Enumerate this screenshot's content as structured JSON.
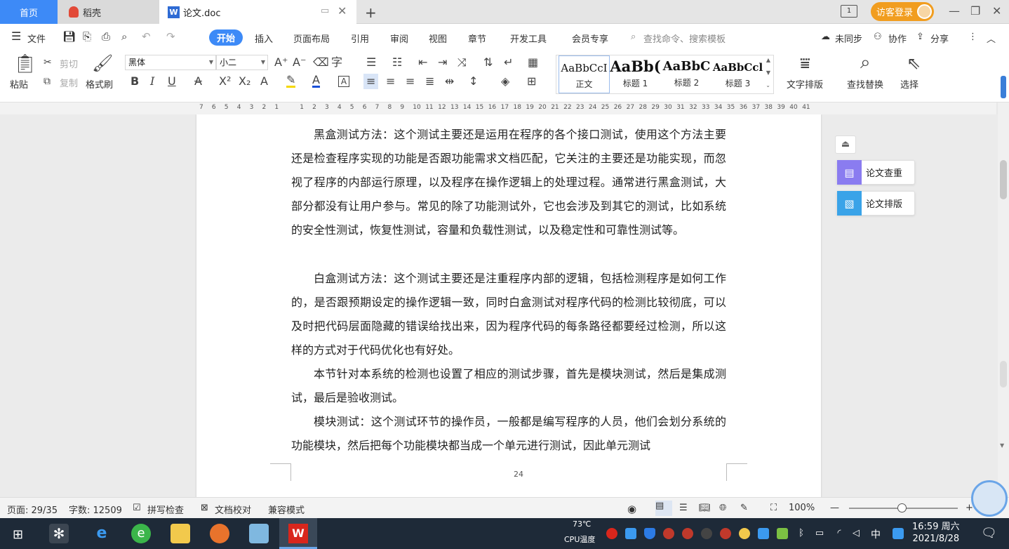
{
  "tabs": [
    {
      "label": "首页"
    },
    {
      "label": "稻壳"
    },
    {
      "label": "论文.doc"
    }
  ],
  "account": {
    "login_label": "访客登录"
  },
  "menu": {
    "file": "文件",
    "items": [
      "开始",
      "插入",
      "页面布局",
      "引用",
      "审阅",
      "视图",
      "章节",
      "开发工具",
      "会员专享"
    ],
    "search_placeholder": "查找命令、搜索模板",
    "sync": "未同步",
    "collab": "协作",
    "share": "分享"
  },
  "ribbon": {
    "paste": "粘贴",
    "cut": "剪切",
    "copy": "复制",
    "format_painter": "格式刷",
    "font_name": "黑体",
    "font_size": "小二",
    "styles": [
      {
        "preview": "AaBbCcI",
        "name": "正文"
      },
      {
        "preview": "AaBb(",
        "name": "标题 1"
      },
      {
        "preview": "AaBbC",
        "name": "标题 2"
      },
      {
        "preview": "AaBbCcl",
        "name": "标题 3"
      }
    ],
    "text_layout": "文字排版",
    "find_replace": "查找替换",
    "select": "选择"
  },
  "ruler": {
    "ticks": [
      "7",
      "6",
      "5",
      "4",
      "3",
      "2",
      "1",
      "",
      "1",
      "2",
      "3",
      "4",
      "5",
      "6",
      "7",
      "8",
      "9",
      "10",
      "11",
      "12",
      "13",
      "14",
      "15",
      "16",
      "17",
      "18",
      "19",
      "20",
      "21",
      "22",
      "23",
      "24",
      "25",
      "26",
      "27",
      "28",
      "29",
      "30",
      "31",
      "32",
      "33",
      "34",
      "35",
      "36",
      "37",
      "38",
      "39",
      "40",
      "41"
    ]
  },
  "document": {
    "paragraphs": [
      "黑盒测试方法：这个测试主要还是运用在程序的各个接口测试，使用这个方法主要还是检查程序实现的功能是否跟功能需求文档匹配，它关注的主要还是功能实现，而忽视了程序的内部运行原理，以及程序在操作逻辑上的处理过程。通常进行黑盒测试，大部分都没有让用户参与。常见的除了功能测试外，它也会涉及到其它的测试，比如系统的安全性测试，恢复性测试，容量和负载性测试，以及稳定性和可靠性测试等。",
      "白盒测试方法：这个测试主要还是注重程序内部的逻辑，包括检测程序是如何工作的，是否跟预期设定的操作逻辑一致，同时白盒测试对程序代码的检测比较彻底，可以及时把代码层面隐藏的错误给找出来，因为程序代码的每条路径都要经过检测，所以这样的方式对于代码优化也有好处。",
      "本节针对本系统的检测也设置了相应的测试步骤，首先是模块测试，然后是集成测试，最后是验收测试。",
      "模块测试：这个测试环节的操作员，一般都是编写程序的人员，他们会划分系统的功能模块，然后把每个功能模块都当成一个单元进行测试，因此单元测试"
    ],
    "page_number": "24"
  },
  "side_panel": {
    "check": "论文查重",
    "layout": "论文排版"
  },
  "status": {
    "page": "页面: 29/35",
    "words": "字数: 12509",
    "spell": "拼写检查",
    "proof": "文档校对",
    "compat": "兼容模式",
    "zoom": "100%"
  },
  "taskbar": {
    "cpu_temp": "73℃",
    "cpu_label": "CPU温度",
    "ime": "中",
    "time": "16:59 周六",
    "date": "2021/8/28"
  },
  "colors": {
    "accent": "#3d8af7",
    "login": "#f19d1f",
    "wps_red": "#d9261c"
  }
}
